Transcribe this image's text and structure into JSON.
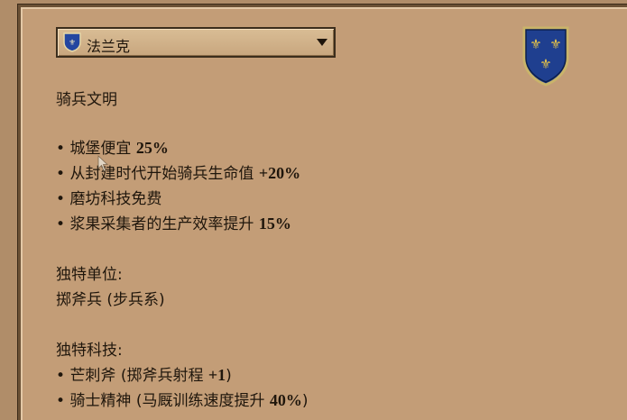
{
  "civ_selector": {
    "selected": "法兰克",
    "flag_icon": "france-fleur-de-lis-shield",
    "arrow_icon": "chevron-down-icon"
  },
  "crest_icon": "france-fleur-de-lis-crest",
  "description": {
    "civ_type": "骑兵文明",
    "bonuses": [
      {
        "text": "城堡便宜 ",
        "num": "25%"
      },
      {
        "text": "从封建时代开始骑兵生命值 ",
        "num": "+20%"
      },
      {
        "text": "磨坊科技免费",
        "num": ""
      },
      {
        "text": "浆果采集者的生产效率提升 ",
        "num": "15%"
      }
    ],
    "unique_unit_header": "独特单位:",
    "unique_unit": "掷斧兵 (步兵系)",
    "unique_tech_header": "独特科技:",
    "unique_techs": [
      {
        "text": "芒刺斧 (掷斧兵射程 ",
        "num": "+1",
        "tail": ")"
      },
      {
        "text": "骑士精神 (马厩训练速度提升 ",
        "num": "40%",
        "tail": ")"
      }
    ]
  },
  "colors": {
    "panel": "#c39d77",
    "frame": "#6b5135",
    "text": "#1f160c",
    "shield_blue": "#1f3f8f",
    "gold": "#e7c347"
  }
}
